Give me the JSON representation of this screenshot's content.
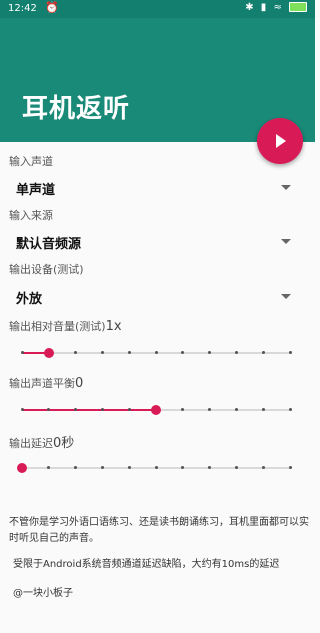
{
  "status_bar": {
    "time": "12:42",
    "alarm_icon": "alarm-icon",
    "right_icons": "✱ ▮ ≈ ⚡"
  },
  "app": {
    "title": "耳机返听",
    "accent": "#d81b57",
    "primary": "#1a8a78"
  },
  "fab": {
    "icon": "play-icon"
  },
  "input_channel": {
    "label": "输入声道",
    "value": "单声道"
  },
  "input_source": {
    "label": "输入来源",
    "value": "默认音频源"
  },
  "output_device": {
    "label": "输出设备(测试)",
    "value": "外放"
  },
  "volume": {
    "label": "输出相对音量(测试)",
    "value_text": "1x",
    "value": 1,
    "steps": 10
  },
  "balance": {
    "label": "输出声道平衡",
    "value_text": "0",
    "value": 0,
    "min": -5,
    "max": 5
  },
  "delay": {
    "label": "输出延迟",
    "value_text": "0秒",
    "value": 0,
    "steps": 10
  },
  "description": {
    "para1": "不管你是学习外语口语练习、还是读书朗诵练习，耳机里面都可以实时听见自己的声音。",
    "para2": "受限于Android系统音频通道延迟缺陷，大约有10ms的延迟",
    "author": "@一块小板子"
  }
}
